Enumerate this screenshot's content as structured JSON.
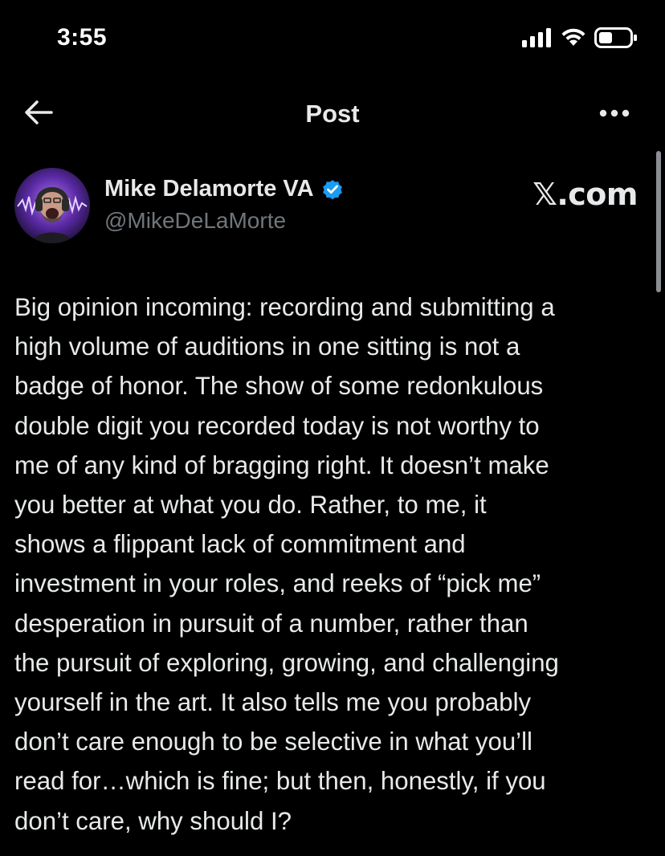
{
  "status_bar": {
    "time": "3:55",
    "icons": [
      "cellular-signal-icon",
      "wifi-icon",
      "battery-icon"
    ]
  },
  "header": {
    "title": "Post",
    "back_icon": "back-arrow-icon",
    "more_icon": "more-options-icon"
  },
  "author": {
    "name": "Mike Delamorte VA",
    "handle": "@MikeDeLaMorte",
    "verified": true,
    "verified_icon": "verified-badge-icon"
  },
  "brand": {
    "watermark": "𝕏.com"
  },
  "post": {
    "text": "Big opinion incoming: recording and submitting a\nhigh volume of auditions in one sitting is not a\nbadge of honor. The show of some redonkulous\ndouble digit you recorded today is not worthy to\nme of any kind of bragging right. It doesn’t make\nyou better at what you do. Rather, to me, it\nshows a flippant lack of commitment and\ninvestment in your roles, and reeks of “pick me”\ndesperation in pursuit of a number, rather than\nthe pursuit of exploring, growing, and challenging\nyourself in the art. It also tells me you probably\ndon’t care enough to be selective in what you’ll\nread for…which is fine; but then, honestly, if you\ndon’t care, why should I?"
  },
  "colors": {
    "background": "#000000",
    "text_primary": "#e7e9ea",
    "text_secondary": "#71767b",
    "verified_blue": "#1d9bf0",
    "avatar_glow": "#7a3fd1"
  }
}
